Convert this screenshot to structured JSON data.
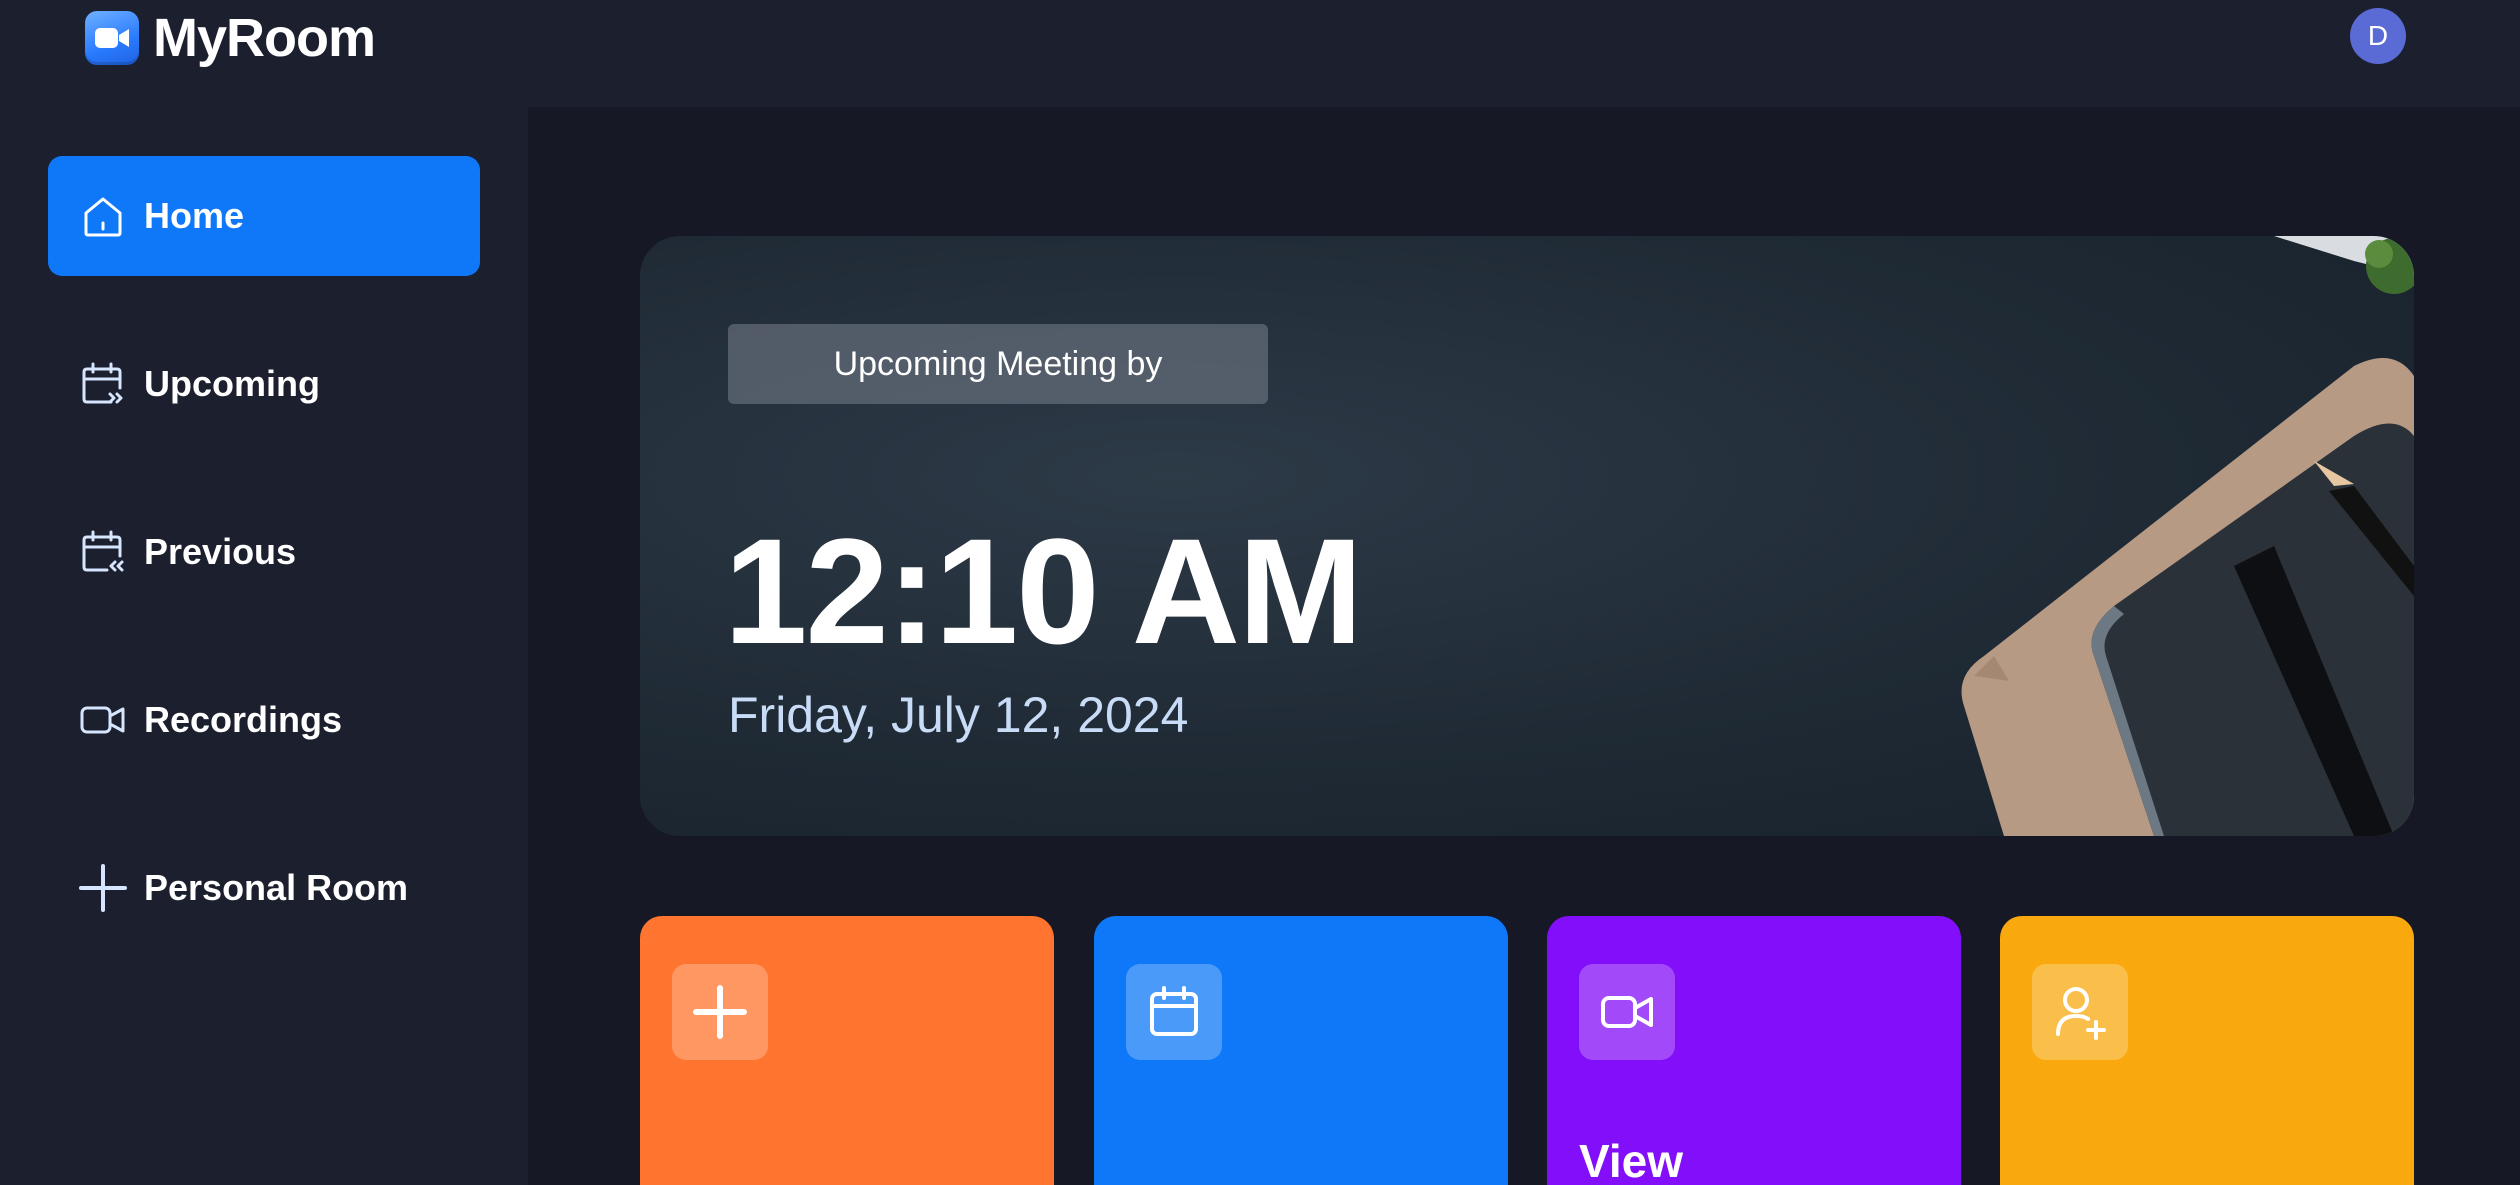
{
  "app": {
    "name": "MyRoom",
    "logo_icon": "video-camera-icon",
    "accent_color": "#0e78f9"
  },
  "user": {
    "avatar_initial": "D"
  },
  "sidebar": {
    "items": [
      {
        "label": "Home",
        "icon": "home-icon",
        "active": true
      },
      {
        "label": "Upcoming",
        "icon": "calendar-forward-icon",
        "active": false
      },
      {
        "label": "Previous",
        "icon": "calendar-back-icon",
        "active": false
      },
      {
        "label": "Recordings",
        "icon": "video-icon",
        "active": false
      },
      {
        "label": "Personal Room",
        "icon": "plus-icon",
        "active": false
      }
    ]
  },
  "hero": {
    "badge": "Upcoming Meeting by",
    "time": "12:10 AM",
    "date": "Friday, July 12, 2024"
  },
  "cards": [
    {
      "icon": "plus-icon",
      "title": "",
      "color": "#ff742e"
    },
    {
      "icon": "calendar-icon",
      "title": "",
      "color": "#0e78f9"
    },
    {
      "icon": "video-icon",
      "title": "View",
      "color": "#830ef9"
    },
    {
      "icon": "add-user-icon",
      "title": "",
      "color": "#f9a90e"
    }
  ]
}
